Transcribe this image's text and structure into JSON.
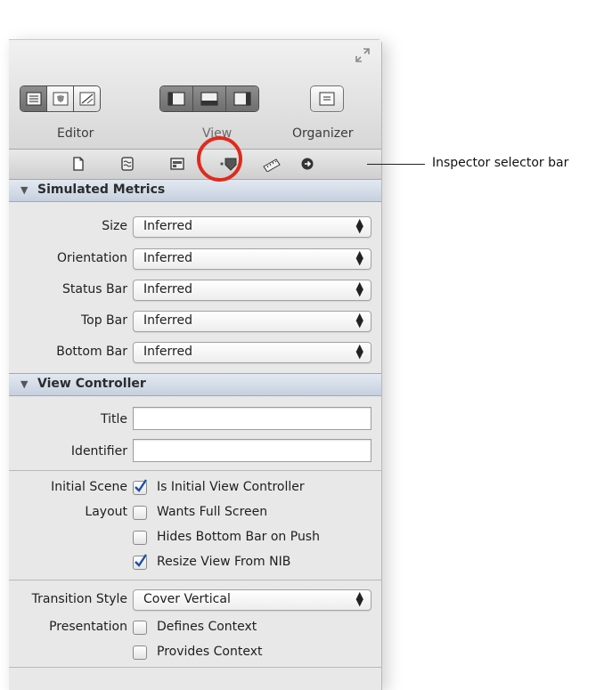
{
  "toolbar": {
    "editor_label": "Editor",
    "view_label": "View",
    "organizer_label": "Organizer"
  },
  "selector_bar": {
    "icons": [
      "file-inspector-icon",
      "quick-help-icon",
      "identity-inspector-icon",
      "attributes-inspector-icon",
      "size-inspector-icon",
      "connections-inspector-icon"
    ],
    "selected": "attributes-inspector-icon"
  },
  "callout": {
    "text": "Inspector selector bar",
    "color": "#e02a1d"
  },
  "simulated_metrics": {
    "title": "Simulated Metrics",
    "rows": [
      {
        "label": "Size",
        "value": "Inferred"
      },
      {
        "label": "Orientation",
        "value": "Inferred"
      },
      {
        "label": "Status Bar",
        "value": "Inferred"
      },
      {
        "label": "Top Bar",
        "value": "Inferred"
      },
      {
        "label": "Bottom Bar",
        "value": "Inferred"
      }
    ]
  },
  "view_controller": {
    "title": "View Controller",
    "title_label": "Title",
    "title_value": "",
    "identifier_label": "Identifier",
    "identifier_value": "",
    "initial_scene_label": "Initial Scene",
    "is_initial_label": "Is Initial View Controller",
    "is_initial_checked": true,
    "layout_label": "Layout",
    "wants_full_screen_label": "Wants Full Screen",
    "wants_full_screen_checked": false,
    "hides_bottom_bar_label": "Hides Bottom Bar on Push",
    "hides_bottom_bar_checked": false,
    "resize_view_label": "Resize View From NIB",
    "resize_view_checked": true,
    "transition_style_label": "Transition Style",
    "transition_style_value": "Cover Vertical",
    "presentation_label": "Presentation",
    "defines_context_label": "Defines Context",
    "defines_context_checked": false,
    "provides_context_label": "Provides Context",
    "provides_context_checked": false
  },
  "colors": {
    "accent_check": "#1d4fa8",
    "section_header": "#cdd6e3"
  }
}
